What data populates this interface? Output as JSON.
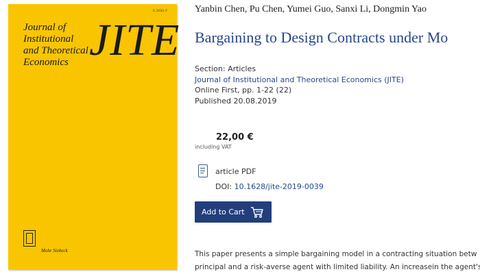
{
  "cover": {
    "code": "E 20561 F",
    "journal_lines": [
      "Journal of",
      "Institutional",
      "and Theoretical",
      "Economics"
    ],
    "abbreviation": "JITE",
    "publisher": "Mohr Siebeck",
    "background_color": "#f9c500"
  },
  "article": {
    "authors": "Yanbin Chen, Pu Chen, Yumei Guo, Sanxi Li, Dongmin Yao",
    "title": "Bargaining to Design Contracts under Mo",
    "section": "Section: Articles",
    "journal": "Journal of Institutional and Theoretical Economics (JITE)",
    "online": "Online First, pp. 1-22 (22)",
    "published": "Published 20.08.2019"
  },
  "purchase": {
    "price": "22,00 €",
    "vat_note": "including VAT",
    "format_icon": "pdf-document-icon",
    "format_label": "article PDF",
    "doi_label": "DOI: ",
    "doi_value": "10.1628/jite-2019-0039",
    "add_to_cart_label": "Add to Cart",
    "cart_icon": "shopping-cart-icon"
  },
  "abstract": {
    "lines": [
      "This paper presents a simple bargaining model in a contracting situation betw",
      "principal and a risk-averse agent with limited liability. An increasein the agent's"
    ]
  },
  "colors": {
    "link": "#27478a",
    "button": "#223f7c"
  }
}
